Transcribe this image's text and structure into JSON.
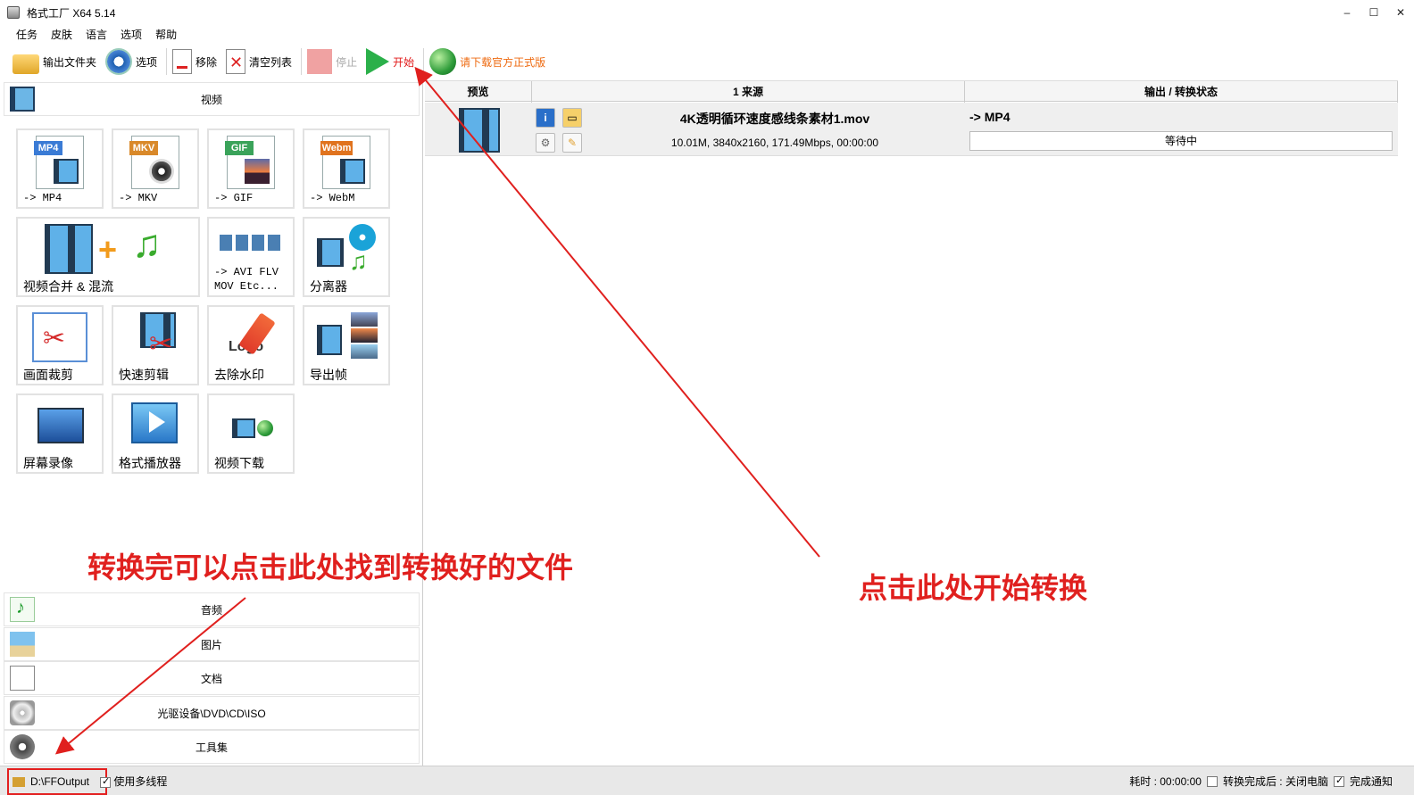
{
  "window": {
    "title": "格式工厂 X64 5.14",
    "minimize": "–",
    "maximize": "☐",
    "close": "✕"
  },
  "menu": [
    "任务",
    "皮肤",
    "语言",
    "选项",
    "帮助"
  ],
  "toolbar": {
    "output_folder": "输出文件夹",
    "options": "选项",
    "remove": "移除",
    "clear_list": "清空列表",
    "stop": "停止",
    "start": "开始",
    "download_official": "请下载官方正式版"
  },
  "categories": {
    "video": "视频",
    "audio": "音频",
    "picture": "图片",
    "document": "文档",
    "disc": "光驱设备\\DVD\\CD\\ISO",
    "tools": "工具集"
  },
  "tiles": {
    "mp4": {
      "tag": "MP4",
      "label": "-> MP4"
    },
    "mkv": {
      "tag": "MKV",
      "label": "-> MKV"
    },
    "gif": {
      "tag": "GIF",
      "label": "-> GIF"
    },
    "webm": {
      "tag": "Webm",
      "label": "-> WebM"
    },
    "merge": "视频合并 & 混流",
    "avi": "-> AVI FLV\nMOV Etc...",
    "splitter": "分离器",
    "crop": "画面裁剪",
    "quick_clip": "快速剪辑",
    "remove_watermark": "去除水印",
    "export_frames": "导出帧",
    "screen_record": "屏幕录像",
    "player": "格式播放器",
    "video_download": "视频下载",
    "logo_text": "Logo"
  },
  "grid": {
    "headers": {
      "preview": "预览",
      "source": "1 来源",
      "output": "输出 / 转换状态"
    },
    "rows": [
      {
        "name": "4K透明循环速度感线条素材1.mov",
        "info": "10.01M, 3840x2160, 171.49Mbps, 00:00:00",
        "format": "-> MP4",
        "status": "等待中"
      }
    ]
  },
  "statusbar": {
    "output_path": "D:\\FFOutput",
    "multithread": "使用多线程",
    "elapsed": "耗时 : 00:00:00",
    "after_convert": "转换完成后 : 关闭电脑",
    "notify": "完成通知"
  },
  "annotations": {
    "find_files": "转换完可以点击此处找到转换好的文件",
    "click_start": "点击此处开始转换"
  },
  "colors": {
    "annotation": "#e0201e",
    "start": "#2bb04a",
    "stop": "#f0a2a2",
    "link": "#ee6a10"
  }
}
